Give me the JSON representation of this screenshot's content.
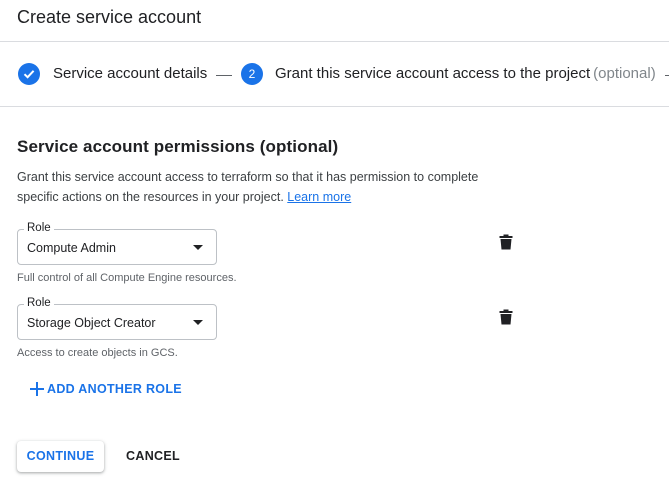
{
  "header": {
    "title": "Create service account"
  },
  "stepper": {
    "step1": {
      "label": "Service account details",
      "status": "complete"
    },
    "step2": {
      "number": "2",
      "label": "Grant this service account access to the project",
      "optional": "(optional)"
    }
  },
  "section": {
    "title": "Service account permissions (optional)",
    "description": "Grant this service account access to terraform so that it has permission to complete specific actions on the resources in your project.",
    "learn_more": "Learn more"
  },
  "roles": [
    {
      "label": "Role",
      "value": "Compute Admin",
      "help": "Full control of all Compute Engine resources."
    },
    {
      "label": "Role",
      "value": "Storage Object Creator",
      "help": "Access to create objects in GCS."
    }
  ],
  "add_role_label": "ADD ANOTHER ROLE",
  "buttons": {
    "continue": "CONTINUE",
    "cancel": "CANCEL"
  },
  "colors": {
    "accent": "#1a73e8",
    "text": "#202124",
    "muted": "#5f6368",
    "border": "#dadce0"
  },
  "icons": {
    "step1": "check-icon",
    "delete": "trash-icon",
    "add": "plus-icon",
    "dropdown": "caret-down-icon"
  }
}
